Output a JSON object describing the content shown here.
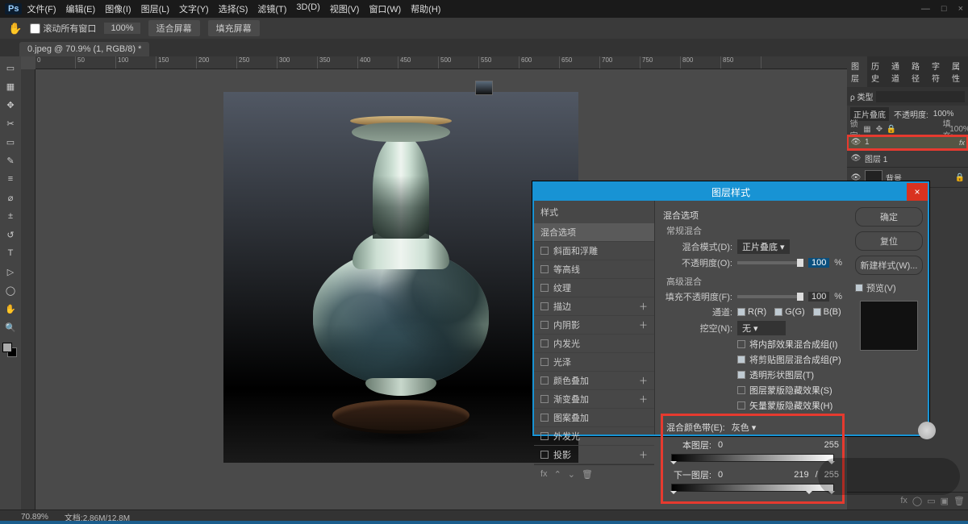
{
  "app": {
    "logo": "Ps"
  },
  "menu": [
    "文件(F)",
    "编辑(E)",
    "图像(I)",
    "图层(L)",
    "文字(Y)",
    "选择(S)",
    "滤镜(T)",
    "3D(D)",
    "视图(V)",
    "窗口(W)",
    "帮助(H)"
  ],
  "window_controls": {
    "min": "—",
    "max": "□",
    "close": "×"
  },
  "options_bar": {
    "scroll_all": "滚动所有窗口",
    "zoom": "100%",
    "fit": "适合屏幕",
    "fill": "填充屏幕"
  },
  "doc_tab": "0.jpeg @ 70.9% (1, RGB/8) *",
  "ruler_marks": [
    "0",
    "50",
    "100",
    "150",
    "200",
    "250",
    "300",
    "350",
    "400",
    "450",
    "500",
    "550",
    "600",
    "650",
    "700",
    "750",
    "800",
    "850"
  ],
  "tools": [
    "▭",
    "▦",
    "✥",
    "✂",
    "▭",
    "✎",
    "≡",
    "⌀",
    "±",
    "↺",
    "T",
    "▷",
    "◯",
    "✋",
    "🔍"
  ],
  "panel_tabs": [
    "图层",
    "历史",
    "通道",
    "路径",
    "字符",
    "属性"
  ],
  "panel": {
    "kind": "ρ 类型",
    "blend": "正片叠底",
    "opacity_label": "不透明度:",
    "opacity_val": "100%",
    "lock_label": "锁定:",
    "fill_label": "填充:",
    "fill_val": "100%"
  },
  "layers": [
    {
      "name": "1",
      "highlight": true,
      "thumb": "vase",
      "fx": "fx"
    },
    {
      "name": "图层 1",
      "thumb": "vase"
    },
    {
      "name": "背景",
      "thumb": "plain",
      "locked": true
    }
  ],
  "dialog": {
    "title": "图层样式",
    "left_header": "样式",
    "left": [
      {
        "label": "混合选项",
        "sel": true,
        "nocb": true
      },
      {
        "label": "斜面和浮雕"
      },
      {
        "label": "等高线"
      },
      {
        "label": "纹理"
      },
      {
        "label": "描边",
        "plus": true
      },
      {
        "label": "内阴影",
        "plus": true
      },
      {
        "label": "内发光"
      },
      {
        "label": "光泽"
      },
      {
        "label": "颜色叠加",
        "plus": true
      },
      {
        "label": "渐变叠加",
        "plus": true
      },
      {
        "label": "图案叠加"
      },
      {
        "label": "外发光"
      },
      {
        "label": "投影",
        "plus": true
      }
    ],
    "mid": {
      "h1": "混合选项",
      "general": "常规混合",
      "mode_label": "混合模式(D):",
      "mode_val": "正片叠底",
      "opacity_label": "不透明度(O):",
      "opacity_val": "100",
      "pct": "%",
      "adv": "高级混合",
      "fill_label": "填充不透明度(F):",
      "fill_val": "100",
      "chan_label": "通道:",
      "chan": [
        "R(R)",
        "G(G)",
        "B(B)"
      ],
      "knockout_label": "挖空(N):",
      "knockout_val": "无",
      "cbs": [
        {
          "t": "将内部效果混合成组(I)",
          "on": false
        },
        {
          "t": "将剪贴图层混合成组(P)",
          "on": true
        },
        {
          "t": "透明形状图层(T)",
          "on": true
        },
        {
          "t": "图层蒙版隐藏效果(S)",
          "on": false
        },
        {
          "t": "矢量蒙版隐藏效果(H)",
          "on": false
        }
      ],
      "blendif_label": "混合颜色带(E):",
      "blendif_val": "灰色",
      "this_label": "本图层:",
      "this_vals": [
        "0",
        "255"
      ],
      "under_label": "下一图层:",
      "under_vals": [
        "0",
        "219",
        "/",
        "255"
      ]
    },
    "right": {
      "ok": "确定",
      "cancel": "复位",
      "new": "新建样式(W)...",
      "preview": "预览(V)"
    }
  },
  "status": {
    "zoom": "70.89%",
    "docinfo": "文档:2.86M/12.8M"
  }
}
